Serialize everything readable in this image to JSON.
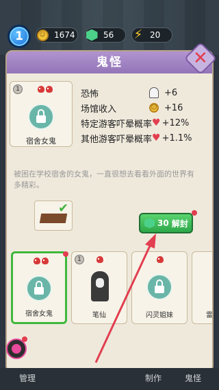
{
  "status": {
    "level": "1",
    "coins": "1674",
    "gems": "56",
    "energy": "20"
  },
  "panel": {
    "title": "鬼怪",
    "close_icon": "close-icon"
  },
  "character": {
    "level_badge": "1",
    "name": "宿舍女鬼",
    "stats": [
      {
        "label": "恐怖",
        "icon": "ghost-icon",
        "value": "+6"
      },
      {
        "label": "场馆收入",
        "icon": "coin-icon",
        "value": "+16"
      },
      {
        "label": "特定游客吓晕概率",
        "icon": "heart-icon",
        "value": "+12%"
      },
      {
        "label": "其他游客吓晕概率",
        "icon": "heart-icon",
        "value": "+1.1%"
      }
    ],
    "description": "被困在学校宿舍的女鬼，一直很想去看看外面的世界有多精彩。"
  },
  "unlock": {
    "cost": "30",
    "label": "解封"
  },
  "list": [
    {
      "name": "宿舍女鬼",
      "level": "",
      "locked": true,
      "selected": true
    },
    {
      "name": "笔仙",
      "level": "1",
      "locked": false,
      "selected": false
    },
    {
      "name": "闪灵姐妹",
      "level": "",
      "locked": true,
      "selected": false
    },
    {
      "name": "雷",
      "level": "",
      "locked": true,
      "selected": false
    }
  ],
  "tabs": {
    "manage": "管理",
    "make": "制作",
    "ghost": "鬼怪"
  },
  "colors": {
    "header_purple": "#9375b8",
    "unlock_green": "#2da84a",
    "accent_red": "#e23e4f"
  }
}
